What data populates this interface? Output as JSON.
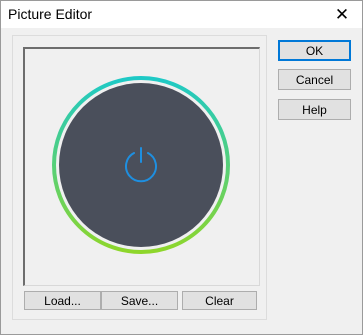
{
  "window": {
    "title": "Picture Editor",
    "close_glyph": "✕"
  },
  "dialog_buttons": {
    "ok": "OK",
    "cancel": "Cancel",
    "help": "Help"
  },
  "picture_buttons": {
    "load": "Load...",
    "save": "Save...",
    "clear": "Clear"
  },
  "picture": {
    "icon": "power-icon",
    "disc_color": "#4a4f5b",
    "ring_gradient": [
      "#1ec9c6",
      "#8ed62b"
    ],
    "icon_color": "#1e8fe0"
  }
}
